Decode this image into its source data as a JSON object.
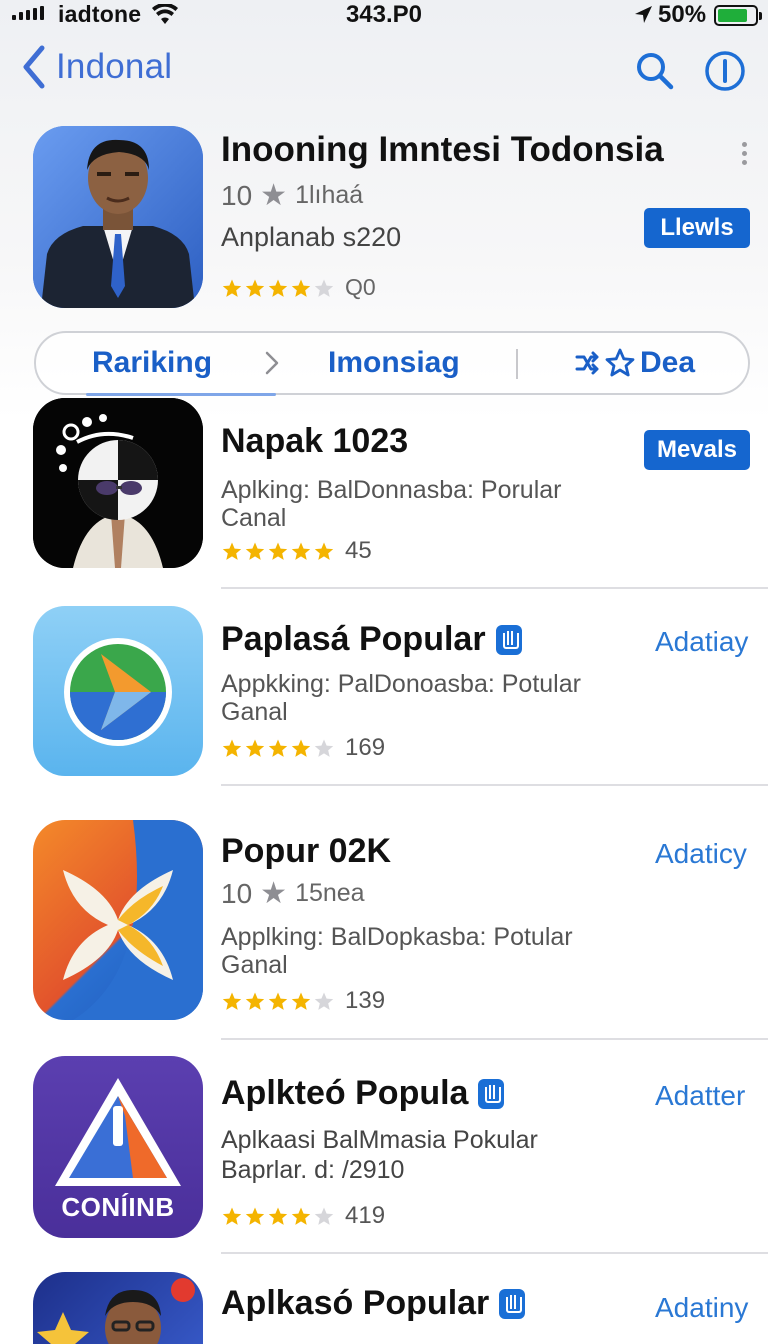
{
  "status_bar": {
    "carrier": "iadtone",
    "time": "343.P0",
    "battery_percent": "50%",
    "battery_level": 0.8,
    "battery_color": "#1fae3a"
  },
  "nav": {
    "back_label": "Indonal",
    "search_icon": "search-icon",
    "info_icon": "info-icon"
  },
  "featured": {
    "title": "Inooning Imntesi Todonsia",
    "rating_number": "10",
    "sub_label": "1lıhaá",
    "developer": "Anplanab s220",
    "stars": 4,
    "rating_count": "Q0",
    "get_label": "Llewls"
  },
  "segment": {
    "tabs": [
      "Rariking",
      "Imonsiag",
      "Dea"
    ],
    "active": 0
  },
  "apps": [
    {
      "name": "Napak 1023",
      "verified": false,
      "desc_line1": "Aplking: BalDonnasba: Porular",
      "desc_line2": "Canal",
      "stars": 5,
      "rating_count": "45",
      "action": "Mevals",
      "action_style": "filled"
    },
    {
      "name": "Paplasá Popular",
      "verified": true,
      "desc_line1": "Appkking: PalDonoasba: Potular",
      "desc_line2": "Ganal",
      "stars": 4,
      "rating_count": "169",
      "action": "Adatiay",
      "action_style": "link"
    },
    {
      "name": "Popur 02K",
      "verified": false,
      "rating_number": "10",
      "sub_label": "15nea",
      "desc_line1": "Applking: BalDopkasba: Potular",
      "desc_line2": "Ganal",
      "stars": 4,
      "rating_count": "139",
      "action": "Adaticy",
      "action_style": "link"
    },
    {
      "name": "Aplkteó Popula",
      "verified": true,
      "desc_line1": "Aplkaasi BalMmasia Pokular",
      "desc_line2": "Baprlar. d: /2910",
      "stars": 4,
      "rating_count": "419",
      "action": "Adatter",
      "action_style": "link",
      "icon_text": "CONÍINB"
    },
    {
      "name": "Aplkasó Popular",
      "verified": true,
      "action": "Adatiny",
      "action_style": "link"
    }
  ],
  "colors": {
    "accent": "#1566cf",
    "link": "#2a78d4",
    "star": "#f4b400"
  }
}
